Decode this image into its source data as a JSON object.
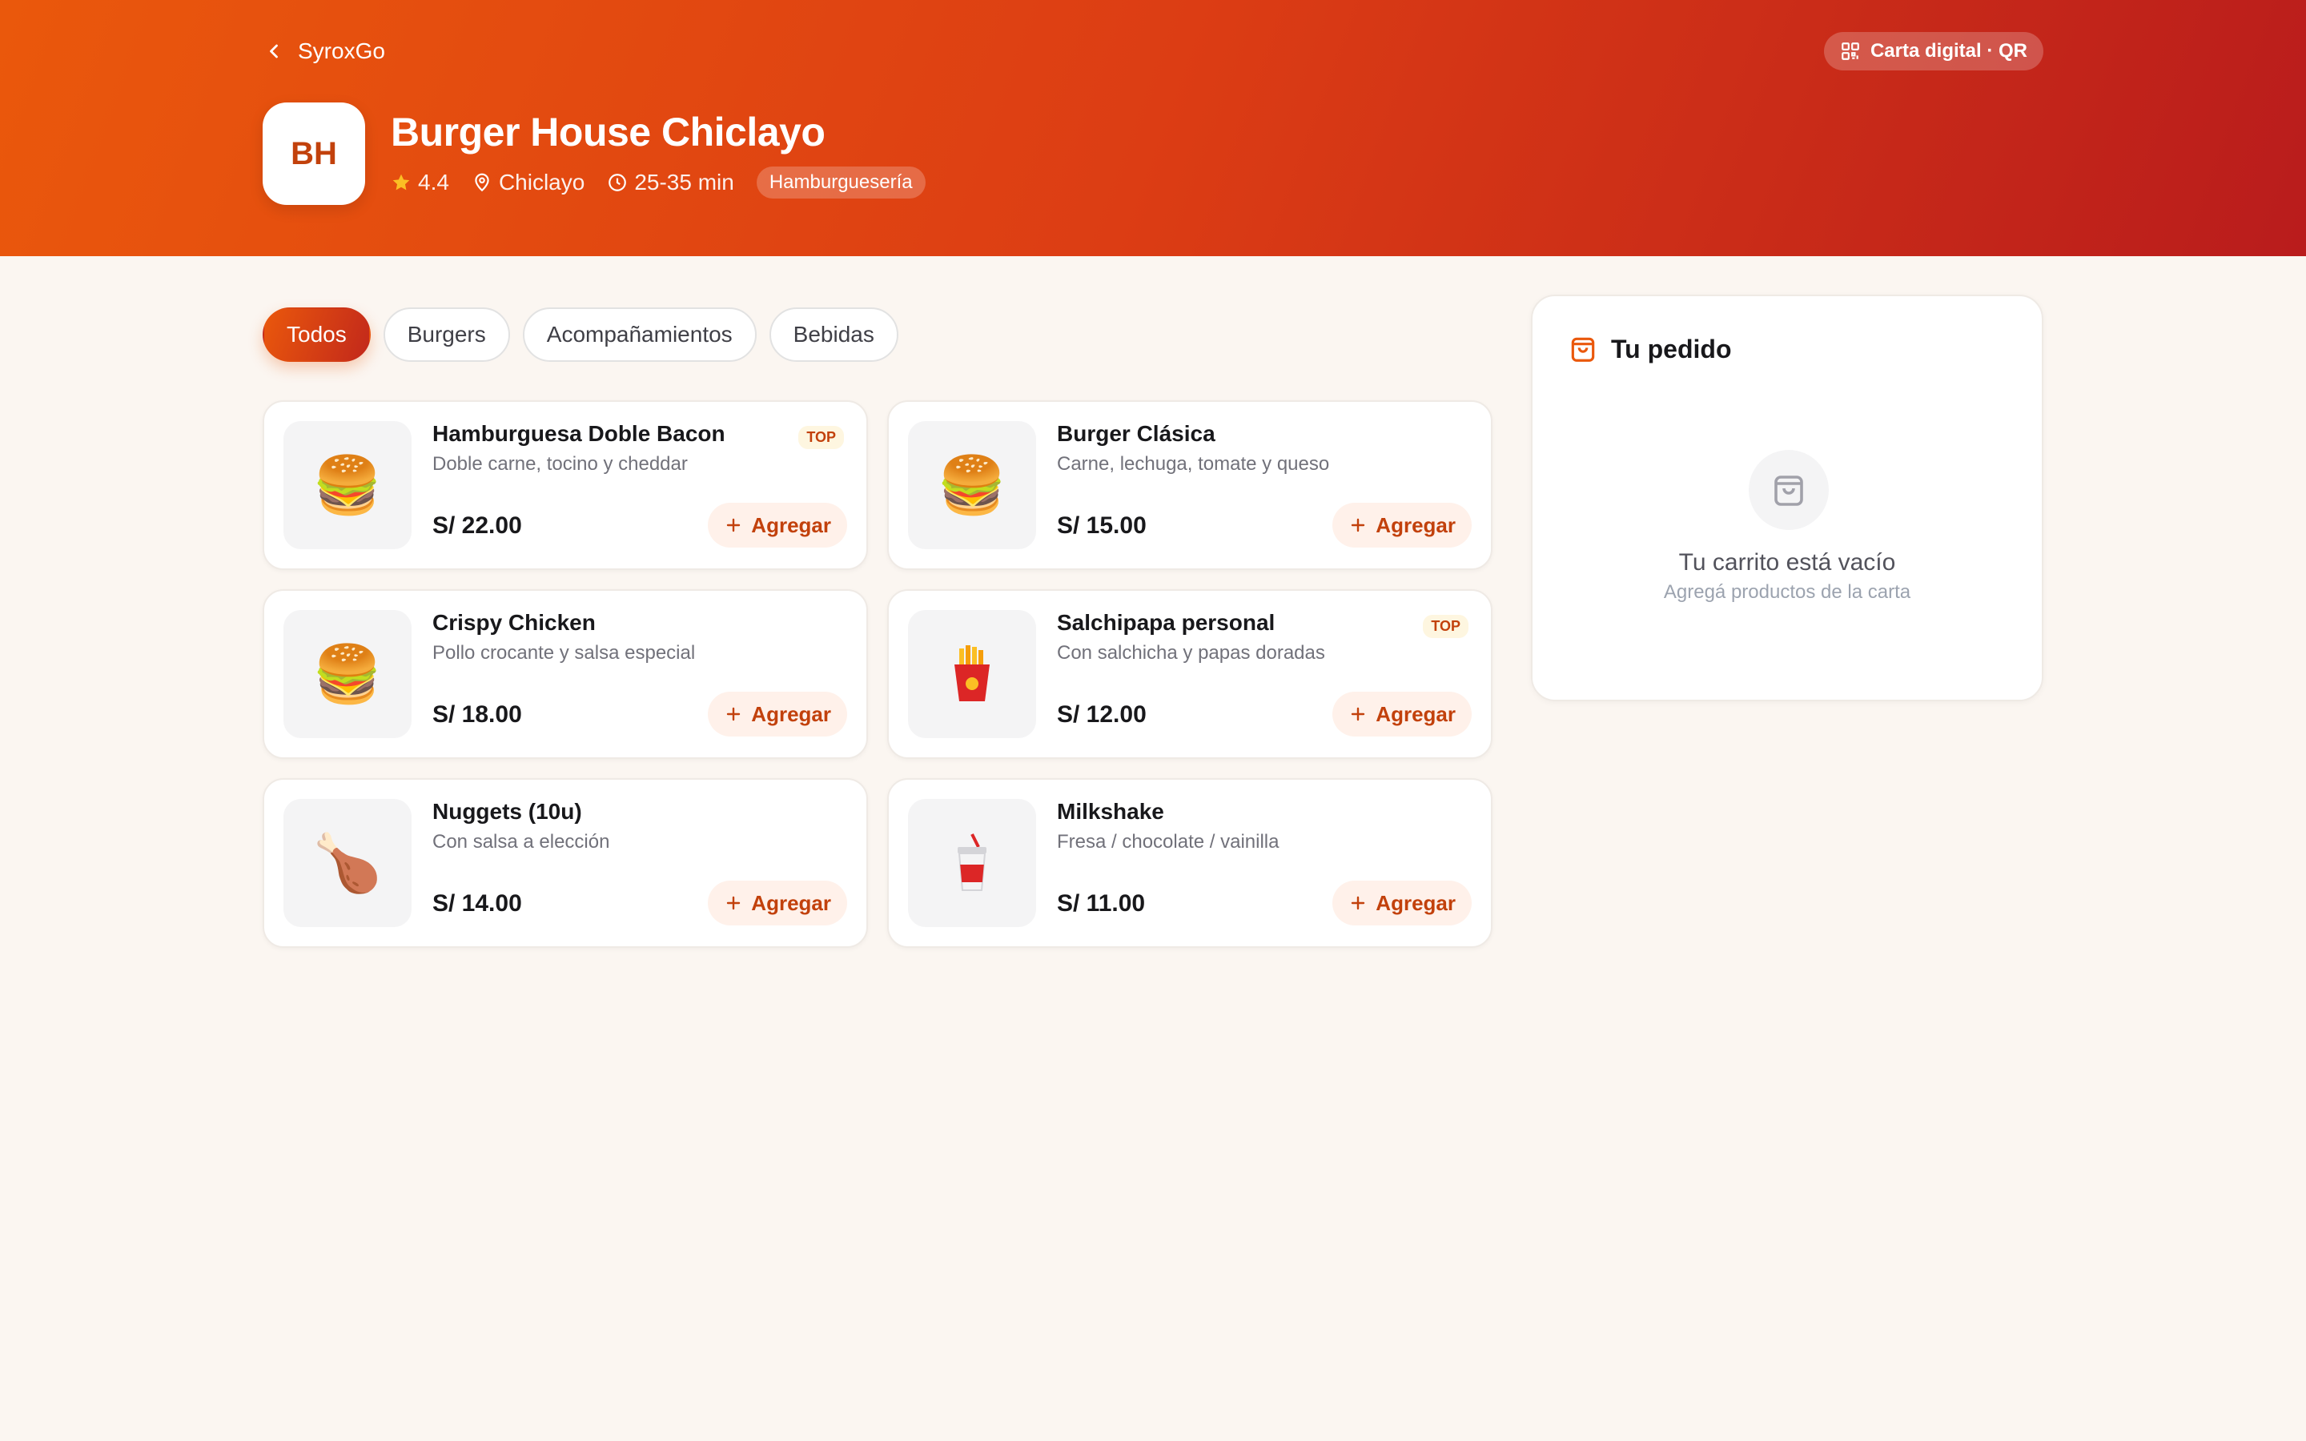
{
  "nav": {
    "back_label": "SyroxGo"
  },
  "header": {
    "qr_label": "Carta digital · QR",
    "logo_initials": "BH",
    "title": "Burger House Chiclayo",
    "rating": "4.4",
    "location": "Chiclayo",
    "delivery_time": "25-35 min",
    "category": "Hamburguesería"
  },
  "tabs": [
    {
      "label": "Todos",
      "active": true
    },
    {
      "label": "Burgers",
      "active": false
    },
    {
      "label": "Acompañamientos",
      "active": false
    },
    {
      "label": "Bebidas",
      "active": false
    }
  ],
  "products": [
    {
      "name": "Hamburguesa Doble Bacon",
      "desc": "Doble carne, tocino y cheddar",
      "price": "S/ 22.00",
      "badge": "TOP",
      "icon": "burger-icon",
      "add_label": "Agregar"
    },
    {
      "name": "Burger Clásica",
      "desc": "Carne, lechuga, tomate y queso",
      "price": "S/ 15.00",
      "badge": "",
      "icon": "burger-icon",
      "add_label": "Agregar"
    },
    {
      "name": "Crispy Chicken",
      "desc": "Pollo crocante y salsa especial",
      "price": "S/ 18.00",
      "badge": "",
      "icon": "burger-icon",
      "add_label": "Agregar"
    },
    {
      "name": "Salchipapa personal",
      "desc": "Con salchicha y papas doradas",
      "price": "S/ 12.00",
      "badge": "TOP",
      "icon": "fries-icon",
      "add_label": "Agregar"
    },
    {
      "name": "Nuggets (10u)",
      "desc": "Con salsa a elección",
      "price": "S/ 14.00",
      "badge": "",
      "icon": "drumstick-icon",
      "add_label": "Agregar"
    },
    {
      "name": "Milkshake",
      "desc": "Fresa / chocolate / vainilla",
      "price": "S/ 11.00",
      "badge": "",
      "icon": "cup-icon",
      "add_label": "Agregar"
    }
  ],
  "cart": {
    "title": "Tu pedido",
    "empty_title": "Tu carrito está vacío",
    "empty_sub": "Agregá productos de la carta"
  },
  "colors": {
    "brand_start": "#EA580C",
    "brand_end": "#B91C1C",
    "accent_text": "#C2410C",
    "background": "#FBF6F1",
    "star": "#FBBF24"
  }
}
